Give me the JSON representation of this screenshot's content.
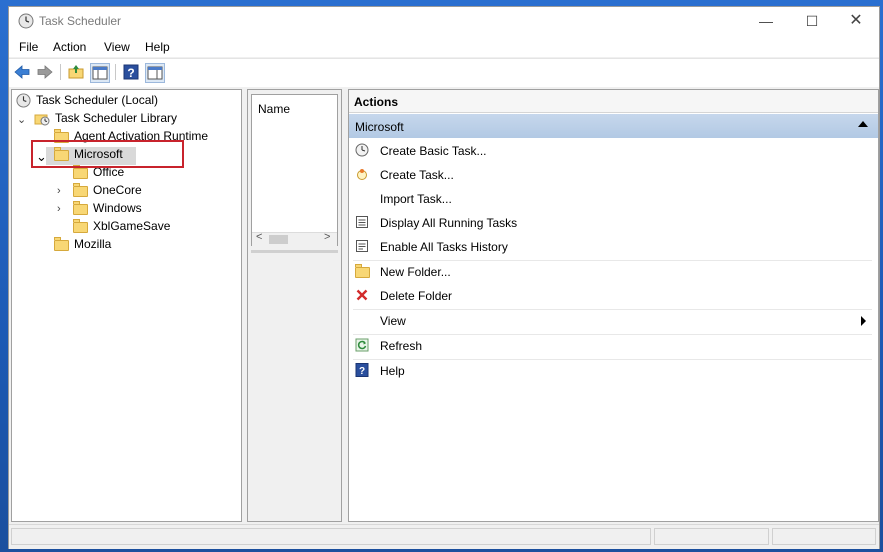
{
  "window": {
    "title": "Task Scheduler",
    "controls": {
      "minimize": "—",
      "maximize": "☐",
      "close": "✕"
    }
  },
  "menu": [
    "File",
    "Action",
    "View",
    "Help"
  ],
  "toolbar": {
    "icons": [
      "back-arrow-icon",
      "forward-arrow-icon",
      "folder-up-icon",
      "show-hide-console-tree-icon",
      "help-icon",
      "show-hide-action-pane-icon"
    ]
  },
  "tree": {
    "root": "Task Scheduler (Local)",
    "library": "Task Scheduler Library",
    "items": {
      "agent": "Agent Activation Runtime",
      "microsoft": "Microsoft",
      "office": "Office",
      "onecore": "OneCore",
      "windows": "Windows",
      "xbl": "XblGameSave",
      "mozilla": "Mozilla"
    },
    "selected": "Microsoft"
  },
  "middle": {
    "column_header": "Name",
    "scroll_left": "<",
    "scroll_right": ">"
  },
  "actions": {
    "header": "Actions",
    "section": "Microsoft",
    "items": [
      {
        "label": "Create Basic Task...",
        "icon": "create-basic-task-icon"
      },
      {
        "label": "Create Task...",
        "icon": "create-task-icon"
      },
      {
        "label": "Import Task...",
        "icon": ""
      },
      {
        "label": "Display All Running Tasks",
        "icon": "running-tasks-icon"
      },
      {
        "label": "Enable All Tasks History",
        "icon": "tasks-history-icon"
      },
      {
        "label": "New Folder...",
        "icon": "new-folder-icon"
      },
      {
        "label": "Delete Folder",
        "icon": "delete-icon"
      },
      {
        "label": "View",
        "icon": ""
      },
      {
        "label": "Refresh",
        "icon": "refresh-icon"
      },
      {
        "label": "Help",
        "icon": "help-icon"
      }
    ]
  },
  "colors": {
    "section_header": "#b8cde6",
    "highlight_box": "#c8232c",
    "folder": "#f8d775",
    "delete_icon": "#d22b2b",
    "help_icon": "#2a4f9e"
  }
}
